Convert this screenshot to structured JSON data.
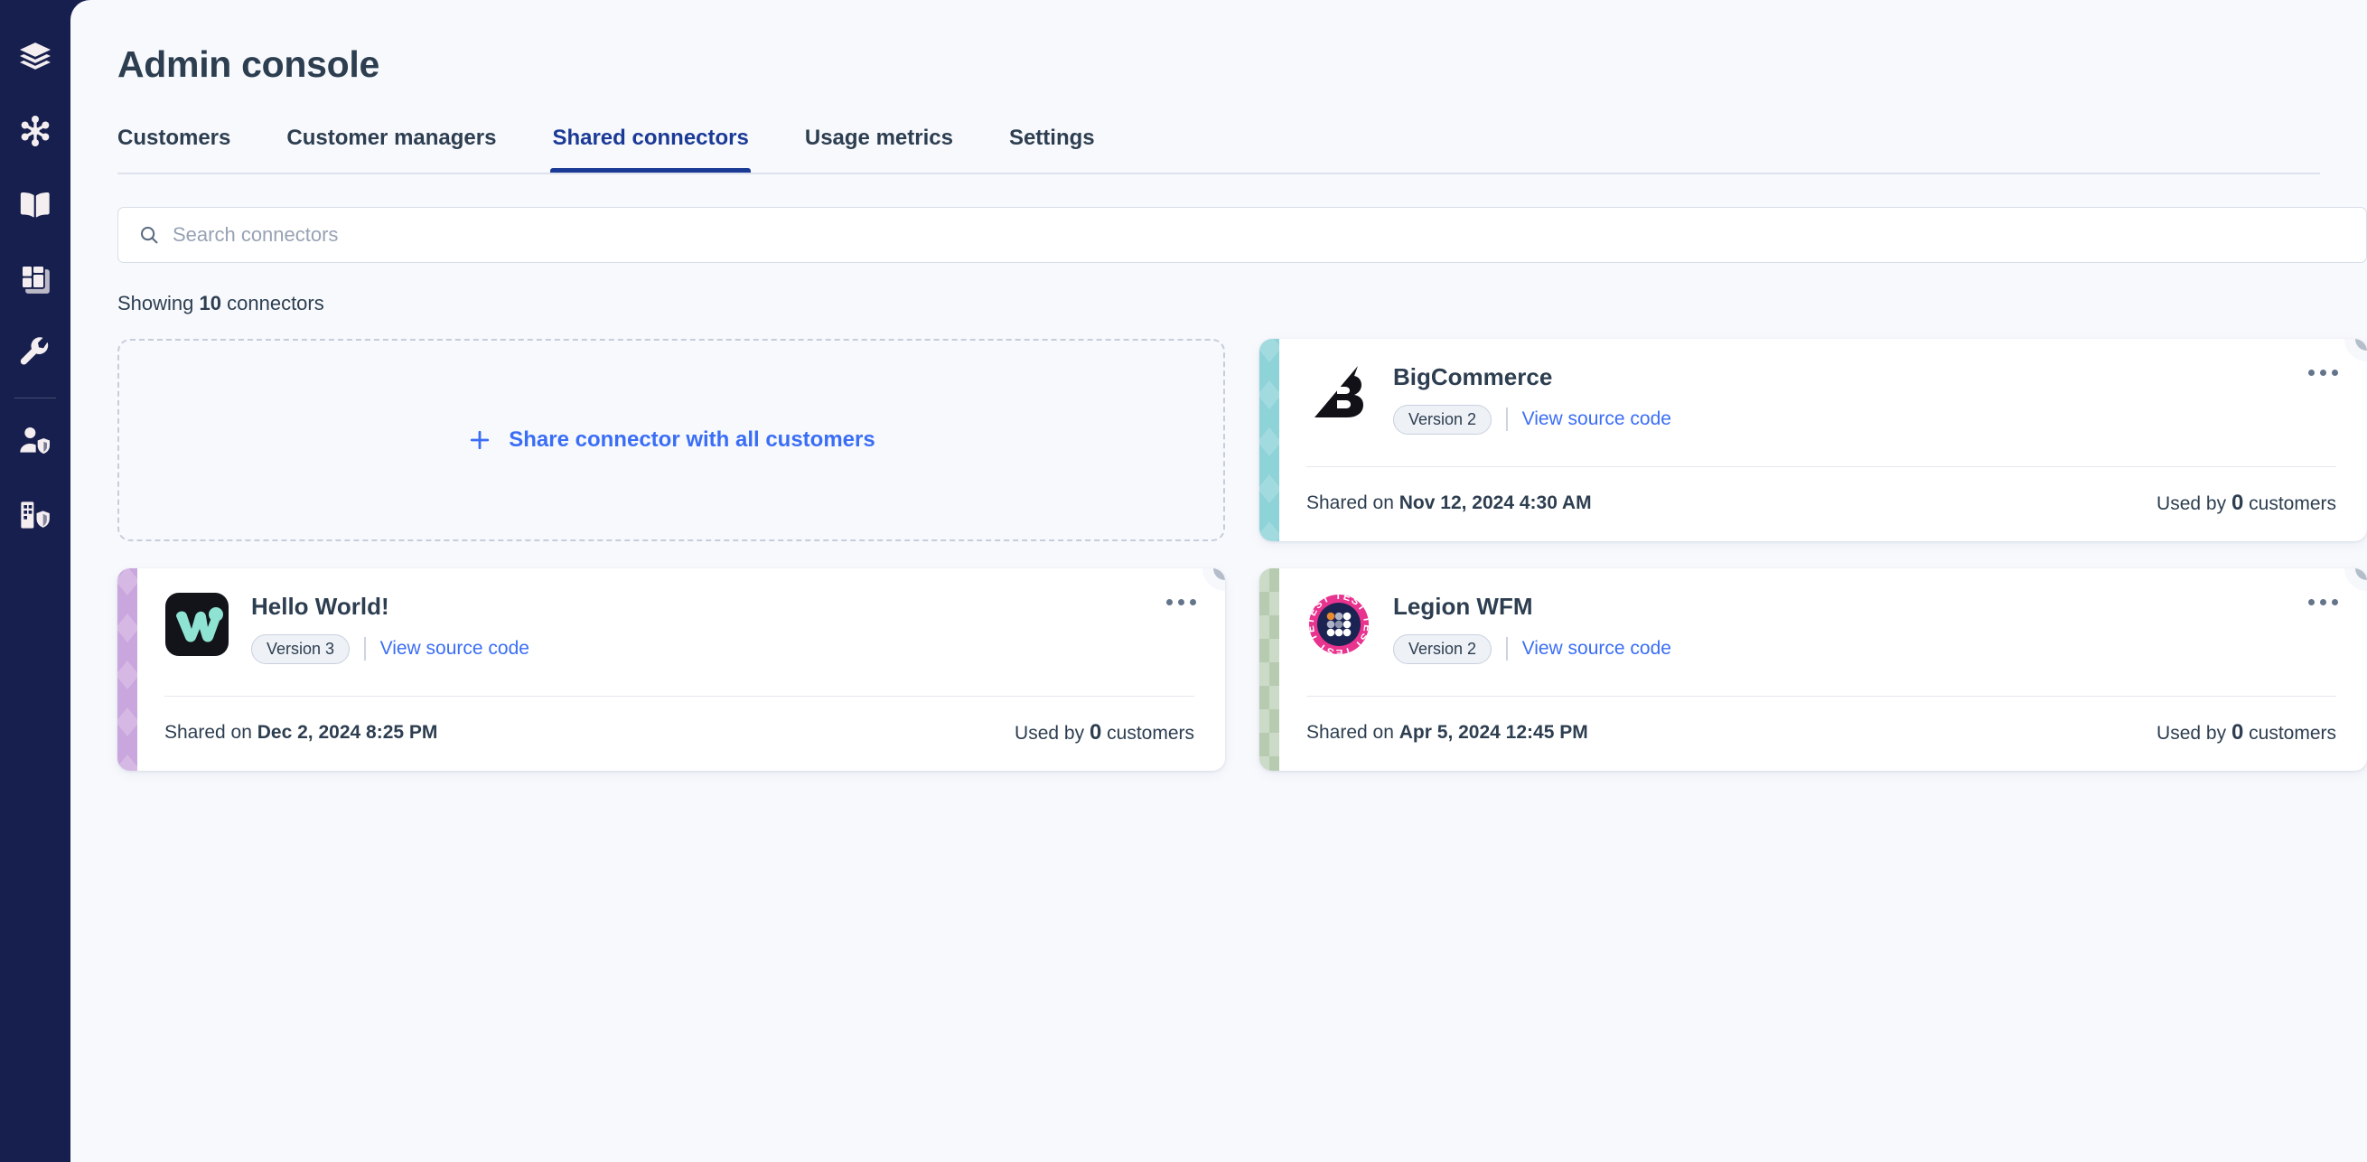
{
  "sidebar": {
    "items": [
      {
        "name": "layers-icon",
        "label": "Layers"
      },
      {
        "name": "snowflake-icon",
        "label": "Integrations"
      },
      {
        "name": "book-icon",
        "label": "Docs"
      },
      {
        "name": "dashboard-icon",
        "label": "Dashboards"
      },
      {
        "name": "wrench-icon",
        "label": "Tools"
      },
      {
        "name": "user-shield-icon",
        "label": "User admin"
      },
      {
        "name": "building-shield-icon",
        "label": "Org admin"
      }
    ]
  },
  "header": {
    "title": "Admin console"
  },
  "tabs": [
    {
      "label": "Customers",
      "active": false
    },
    {
      "label": "Customer managers",
      "active": false
    },
    {
      "label": "Shared connectors",
      "active": true
    },
    {
      "label": "Usage metrics",
      "active": false
    },
    {
      "label": "Settings",
      "active": false
    }
  ],
  "search": {
    "placeholder": "Search connectors",
    "value": "",
    "icon": "search-icon"
  },
  "results": {
    "prefix": "Showing",
    "count": "10",
    "suffix": "connectors"
  },
  "add_card": {
    "label": "Share connector with all customers",
    "icon": "plus-icon"
  },
  "labels": {
    "shared_on": "Shared on",
    "used_by": "Used by",
    "customers": "customers",
    "view_source": "View source code",
    "menu_icon": "kebab-menu-icon"
  },
  "colors": {
    "accent_blue": "#1b3a96",
    "link_blue": "#3b6ef6",
    "sidebar_navy": "#161f4d",
    "page_bg": "#f7f9fd",
    "text_dark": "#2d3e50"
  },
  "connectors": [
    {
      "name": "BigCommerce",
      "version": "Version 2",
      "shared_on": "Nov 12, 2024 4:30 AM",
      "used_by": "0",
      "accent_color": "#8ed3d8",
      "logo": "bigcommerce-logo"
    },
    {
      "name": "Hello World!",
      "version": "Version 3",
      "shared_on": "Dec 2, 2024 8:25 PM",
      "used_by": "0",
      "accent_color": "#c9a6dd",
      "logo": "hello-world-logo"
    },
    {
      "name": "Legion WFM",
      "version": "Version 2",
      "shared_on": "Apr 5, 2024 12:45 PM",
      "used_by": "0",
      "accent_color": "#b7cbb0",
      "logo": "legion-wfm-logo"
    }
  ]
}
